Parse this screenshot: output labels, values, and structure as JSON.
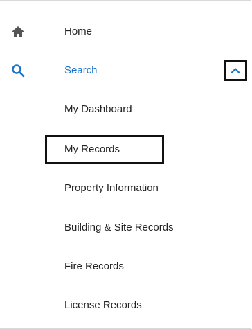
{
  "nav": {
    "home": {
      "label": "Home",
      "icon": "home-icon"
    },
    "search": {
      "label": "Search",
      "icon": "search-icon",
      "expanded": true,
      "toggle_icon": "chevron-up-icon"
    }
  },
  "search_submenu": {
    "items": [
      {
        "label": "My Dashboard"
      },
      {
        "label": "My Records"
      },
      {
        "label": "Property Information"
      },
      {
        "label": "Building & Site Records"
      },
      {
        "label": "Fire Records"
      },
      {
        "label": "License Records"
      }
    ]
  },
  "colors": {
    "accent": "#1a73c8",
    "text": "#222222",
    "icon_gray": "#555555",
    "divider": "#d9d9d9"
  }
}
